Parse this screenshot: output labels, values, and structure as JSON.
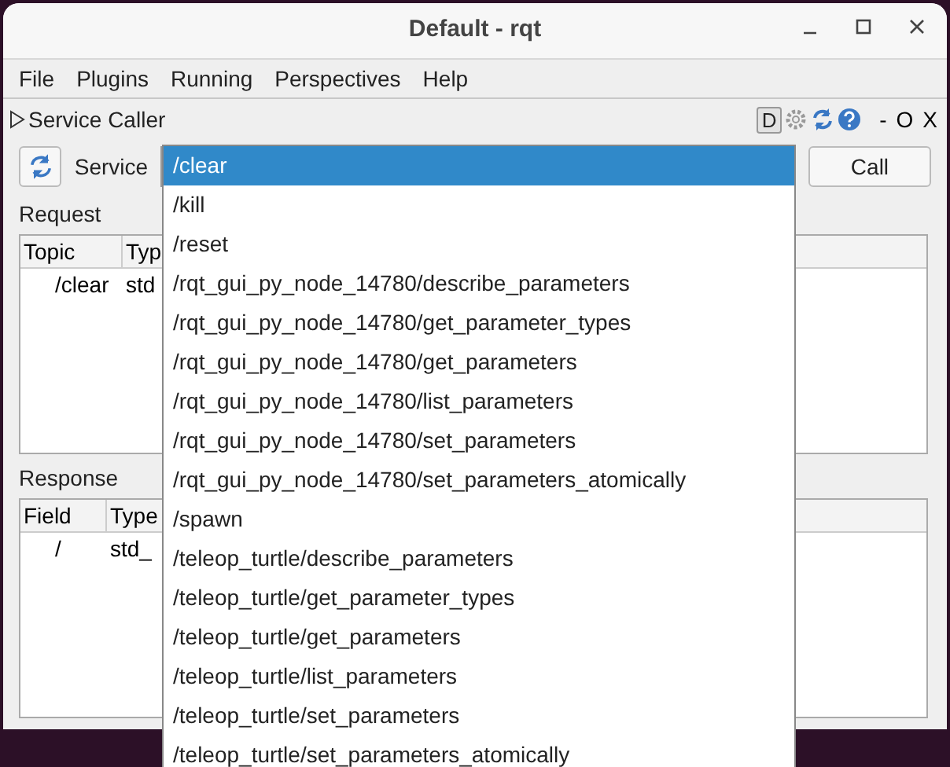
{
  "window": {
    "title": "Default - rqt"
  },
  "menu": [
    "File",
    "Plugins",
    "Running",
    "Perspectives",
    "Help"
  ],
  "plugin": {
    "title": "Service Caller",
    "header_buttons": [
      "D"
    ],
    "dock_controls": [
      "-",
      "O",
      "X"
    ]
  },
  "service": {
    "label": "Service",
    "call_button": "Call"
  },
  "request": {
    "label": "Request",
    "columns": [
      "Topic",
      "Typ"
    ],
    "rows": [
      [
        "/clear",
        "std"
      ]
    ]
  },
  "response": {
    "label": "Response",
    "columns": [
      "Field",
      "Type"
    ],
    "rows": [
      [
        "/",
        "std_"
      ]
    ]
  },
  "dropdown": [
    {
      "label": "/clear",
      "selected": true
    },
    {
      "label": "/kill",
      "selected": false
    },
    {
      "label": "/reset",
      "selected": false
    },
    {
      "label": "/rqt_gui_py_node_14780/describe_parameters",
      "selected": false
    },
    {
      "label": "/rqt_gui_py_node_14780/get_parameter_types",
      "selected": false
    },
    {
      "label": "/rqt_gui_py_node_14780/get_parameters",
      "selected": false
    },
    {
      "label": "/rqt_gui_py_node_14780/list_parameters",
      "selected": false
    },
    {
      "label": "/rqt_gui_py_node_14780/set_parameters",
      "selected": false
    },
    {
      "label": "/rqt_gui_py_node_14780/set_parameters_atomically",
      "selected": false
    },
    {
      "label": "/spawn",
      "selected": false
    },
    {
      "label": "/teleop_turtle/describe_parameters",
      "selected": false
    },
    {
      "label": "/teleop_turtle/get_parameter_types",
      "selected": false
    },
    {
      "label": "/teleop_turtle/get_parameters",
      "selected": false
    },
    {
      "label": "/teleop_turtle/list_parameters",
      "selected": false
    },
    {
      "label": "/teleop_turtle/set_parameters",
      "selected": false
    },
    {
      "label": "/teleop_turtle/set_parameters_atomically",
      "selected": false
    }
  ]
}
